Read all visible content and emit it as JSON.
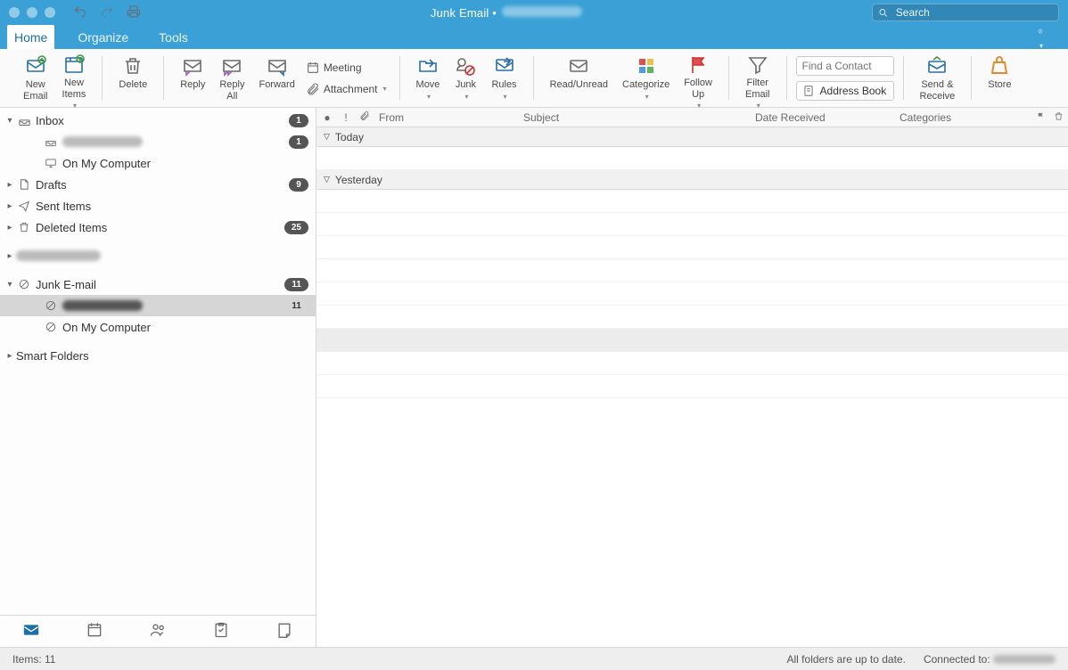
{
  "window": {
    "title": "Junk Email •"
  },
  "search": {
    "placeholder": "Search"
  },
  "tabs": {
    "home": "Home",
    "organize": "Organize",
    "tools": "Tools"
  },
  "ribbon": {
    "new_email": "New\nEmail",
    "new_items": "New\nItems",
    "delete": "Delete",
    "reply": "Reply",
    "reply_all": "Reply\nAll",
    "forward": "Forward",
    "meeting": "Meeting",
    "attachment": "Attachment",
    "move": "Move",
    "junk": "Junk",
    "rules": "Rules",
    "read_unread": "Read/Unread",
    "categorize": "Categorize",
    "follow_up": "Follow\nUp",
    "filter_email": "Filter\nEmail",
    "find_contact_placeholder": "Find a Contact",
    "address_book": "Address Book",
    "send_receive": "Send &\nReceive",
    "store": "Store"
  },
  "sidebar": {
    "inbox": "Inbox",
    "inbox_badge": "1",
    "sub_account_badge": "1",
    "on_my_computer": "On My Computer",
    "drafts": "Drafts",
    "drafts_badge": "9",
    "sent_items": "Sent Items",
    "deleted_items": "Deleted Items",
    "deleted_badge": "25",
    "junk_email": "Junk E-mail",
    "junk_badge": "11",
    "selected_count": "11",
    "on_my_computer2": "On My Computer",
    "smart_folders": "Smart Folders"
  },
  "columns": {
    "from": "From",
    "subject": "Subject",
    "date": "Date Received",
    "categories": "Categories"
  },
  "groups": {
    "today": "Today",
    "yesterday": "Yesterday"
  },
  "status": {
    "items": "Items: 11",
    "uptodate": "All folders are up to date.",
    "connected": "Connected to:"
  },
  "today_rows": 1,
  "yesterday_rows": 9,
  "yesterday_selected": 6,
  "yesterday_attach": 9
}
